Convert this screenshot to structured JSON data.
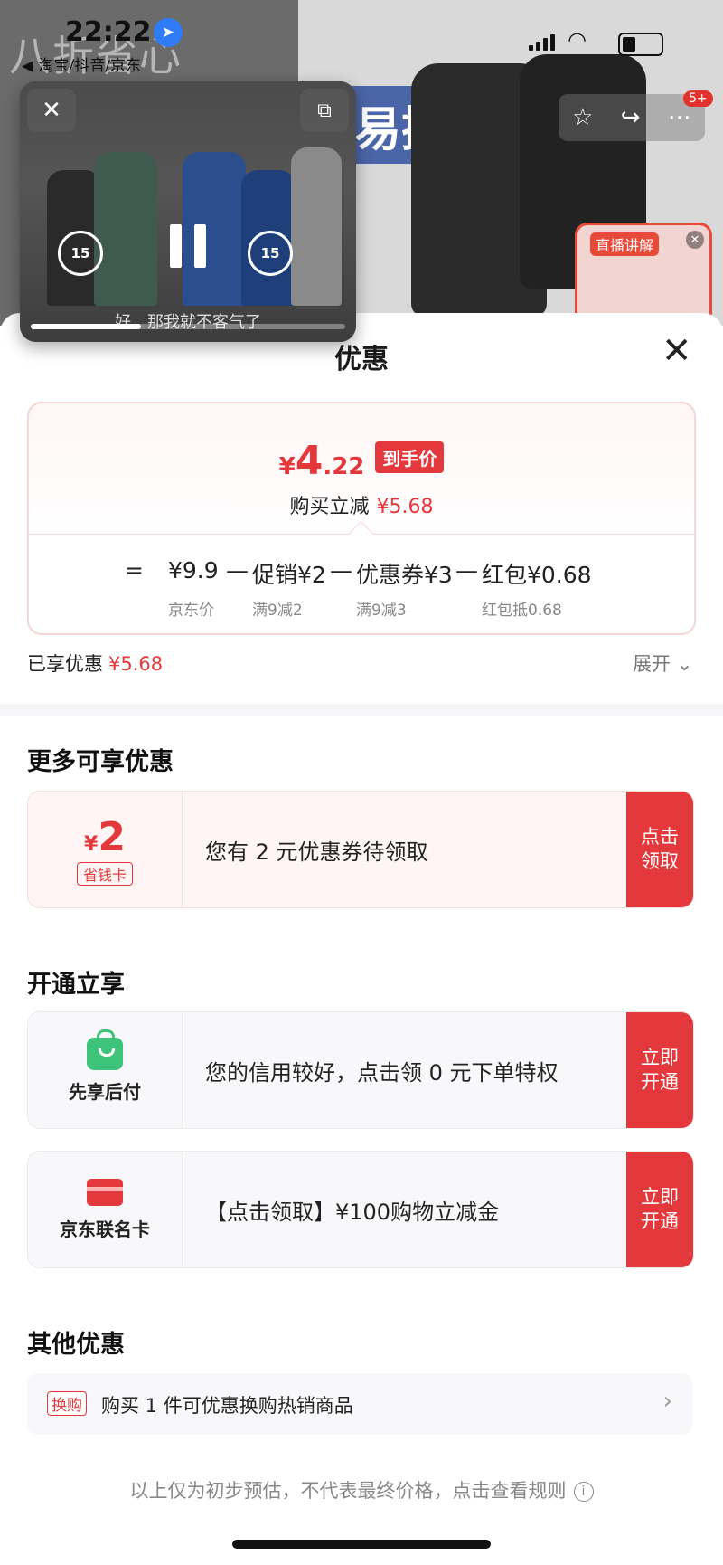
{
  "status_bar": {
    "time": "22:22",
    "sub_label": "◀ 淘宝/抖音/京东"
  },
  "background": {
    "slogan": "八折省心",
    "tear_text": "易撕",
    "live_label": "直播讲解",
    "badge": "5+"
  },
  "pip_player": {
    "skip_back": "15",
    "skip_forward": "15",
    "subtitle": "好，那我就不客气了",
    "progress": 0.35
  },
  "sheet": {
    "title": "优惠",
    "price": {
      "symbol": "¥",
      "integer": "4",
      "decimal": ".22",
      "tag": "到手价"
    },
    "reduction": {
      "label": "购买立减",
      "amount": "¥5.68"
    },
    "formula": {
      "eq": "=",
      "jd_price": "¥9.9",
      "minus1": "—",
      "promo": "促销¥2",
      "minus2": "—",
      "coupon": "优惠券¥3",
      "minus3": "—",
      "redpacket": "红包¥0.68",
      "jd_price_note": "京东价",
      "promo_note": "满9减2",
      "coupon_note": "满9减3",
      "redpacket_note": "红包抵0.68"
    },
    "enjoyed": {
      "label": "已享优惠",
      "amount": "¥5.68"
    },
    "expand_label": "展开 ⌄",
    "more_title": "更多可享优惠",
    "coupon_offer": {
      "symbol": "¥",
      "amount": "2",
      "tag": "省钱卡",
      "text": "您有 2 元优惠券待领取",
      "button": "点击\n领取"
    },
    "open_title": "开通立享",
    "paylater_offer": {
      "label": "先享后付",
      "text": "您的信用较好，点击领 0 元下单特权",
      "button": "立即\n开通"
    },
    "card_offer": {
      "label": "京东联名卡",
      "text": "【点击领取】¥100购物立减金",
      "button": "立即\n开通"
    },
    "other_title": "其他优惠",
    "other_offer": {
      "tag": "换购",
      "text": "购买 1 件可优惠换购热销商品",
      "arrow": "›"
    },
    "footnote": "以上仅为初步预估，不代表最终价格，点击查看规则",
    "info_icon_glyph": "i"
  },
  "colors": {
    "accent_red": "#e4393c",
    "wallet_green": "#3ec47a",
    "nav_blue": "#2f7cf6"
  },
  "icons": [
    "navigation-arrow-icon",
    "signal-icon",
    "wifi-icon",
    "battery-icon",
    "star-icon",
    "share-icon",
    "more-icon",
    "close-icon",
    "restore-window-icon",
    "replay-15-icon",
    "pause-icon",
    "forward-15-icon",
    "chevron-down-icon",
    "shopping-bag-icon",
    "credit-card-icon",
    "chevron-right-icon",
    "info-icon"
  ]
}
